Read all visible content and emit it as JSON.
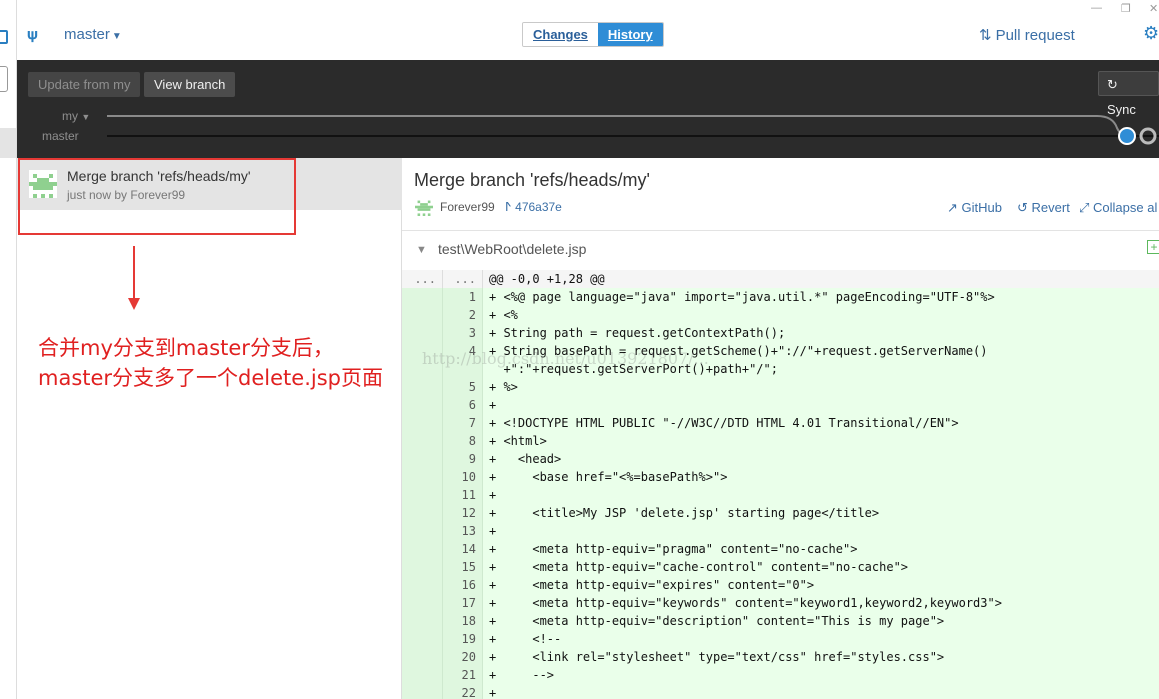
{
  "topbar": {
    "branch": "master",
    "tabs": [
      {
        "label": "Changes",
        "active": false
      },
      {
        "label": "History",
        "active": true
      }
    ],
    "pull_request": "Pull request"
  },
  "toolbar": {
    "update_label": "Update from my",
    "view_branch_label": "View branch",
    "sync_label": "Sync",
    "lane_my": "my",
    "lane_master": "master"
  },
  "commit_list": [
    {
      "title": "Merge branch 'refs/heads/my'",
      "meta": "just now by Forever99"
    }
  ],
  "annotation": {
    "line1": "合并my分支到master分支后，",
    "line2": "master分支多了一个delete.jsp页面"
  },
  "detail": {
    "title": "Merge branch 'refs/heads/my'",
    "author": "Forever99",
    "sha": "476a37e",
    "actions": {
      "github": "GitHub",
      "revert": "Revert",
      "collapse": "Collapse al"
    },
    "file_path": "test\\WebRoot\\delete.jsp",
    "hunk": {
      "left": "...",
      "right": "...",
      "text": "@@ -0,0 +1,28 @@"
    },
    "lines": [
      {
        "n": "1",
        "text": "+ <%@ page language=\"java\" import=\"java.util.*\" pageEncoding=\"UTF-8\"%>"
      },
      {
        "n": "2",
        "text": "+ <%"
      },
      {
        "n": "3",
        "text": "+ String path = request.getContextPath();"
      },
      {
        "n": "4",
        "text": "+ String basePath = request.getScheme()+\"://\"+request.getServerName()"
      },
      {
        "n": "",
        "text": "  +\":\"+request.getServerPort()+path+\"/\";"
      },
      {
        "n": "5",
        "text": "+ %>"
      },
      {
        "n": "6",
        "text": "+"
      },
      {
        "n": "7",
        "text": "+ <!DOCTYPE HTML PUBLIC \"-//W3C//DTD HTML 4.01 Transitional//EN\">"
      },
      {
        "n": "8",
        "text": "+ <html>"
      },
      {
        "n": "9",
        "text": "+   <head>"
      },
      {
        "n": "10",
        "text": "+     <base href=\"<%=basePath%>\">"
      },
      {
        "n": "11",
        "text": "+"
      },
      {
        "n": "12",
        "text": "+     <title>My JSP 'delete.jsp' starting page</title>"
      },
      {
        "n": "13",
        "text": "+"
      },
      {
        "n": "14",
        "text": "+     <meta http-equiv=\"pragma\" content=\"no-cache\">"
      },
      {
        "n": "15",
        "text": "+     <meta http-equiv=\"cache-control\" content=\"no-cache\">"
      },
      {
        "n": "16",
        "text": "+     <meta http-equiv=\"expires\" content=\"0\">"
      },
      {
        "n": "17",
        "text": "+     <meta http-equiv=\"keywords\" content=\"keyword1,keyword2,keyword3\">"
      },
      {
        "n": "18",
        "text": "+     <meta http-equiv=\"description\" content=\"This is my page\">"
      },
      {
        "n": "19",
        "text": "+     <!--"
      },
      {
        "n": "20",
        "text": "+     <link rel=\"stylesheet\" type=\"text/css\" href=\"styles.css\">"
      },
      {
        "n": "21",
        "text": "+     -->"
      },
      {
        "n": "22",
        "text": "+"
      }
    ]
  },
  "watermark": "http://blog.csdn.net/u013921807/...",
  "colors": {
    "accent": "#2f8dd6",
    "added_bg": "#eaffea",
    "annotation": "#e02020"
  }
}
